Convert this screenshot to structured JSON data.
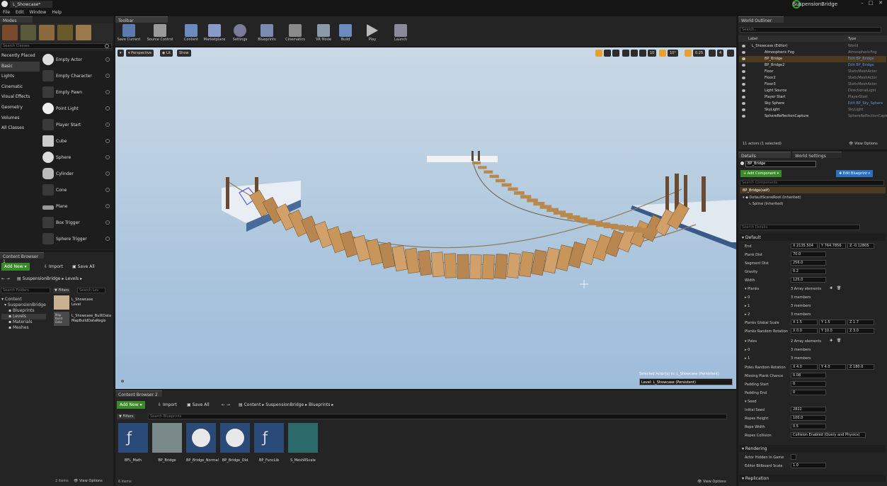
{
  "window": {
    "tab": "L_Showcase*",
    "project": "SuspensionBridge"
  },
  "menu": [
    "File",
    "Edit",
    "Window",
    "Help"
  ],
  "modes": {
    "tab": "Modes",
    "search_placeholder": "Search Classes",
    "categories": [
      "Recently Placed",
      "Basic",
      "Lights",
      "Cinematic",
      "Visual Effects",
      "Geometry",
      "Volumes",
      "All Classes"
    ],
    "selected_category": "Basic",
    "classes": [
      "Empty Actor",
      "Empty Character",
      "Empty Pawn",
      "Point Light",
      "Player Start",
      "Cube",
      "Sphere",
      "Cylinder",
      "Cone",
      "Plane",
      "Box Trigger",
      "Sphere Trigger"
    ]
  },
  "toolbar": {
    "tab": "Toolbar",
    "buttons": [
      "Save Current",
      "Source Control",
      "Content",
      "Marketplace",
      "Settings",
      "Blueprints",
      "Cinematics",
      "VR Mode",
      "Build",
      "Play",
      "Launch"
    ]
  },
  "viewport": {
    "perspective": "Perspective",
    "lit": "Lit",
    "show": "Show",
    "snap_value": "10",
    "rot_value": "10°",
    "scale_value": "0.25",
    "cam_speed": "4",
    "selected_actors": "Selected Actor(s) in: L_Showcase (Persistent)",
    "level": "Level: L_Showcase (Persistent)"
  },
  "content_browser_1": {
    "tab": "Content Browser 1",
    "add_new": "Add New",
    "import": "Import",
    "save_all": "Save All",
    "path": [
      "SuspensionBridge",
      "Levels"
    ],
    "search_folders": "Search Folders",
    "filters": "Filters",
    "search_levels": "Search Lev",
    "tree": [
      "Content",
      "SuspensionBridge",
      "Blueprints",
      "Levels",
      "Materials",
      "Meshes"
    ],
    "assets": [
      {
        "name": "L_Showcase",
        "type": "Level"
      },
      {
        "name": "L_Showcase_BuiltData",
        "type": "MapBuildDataRegis"
      }
    ],
    "asset_thumb_label": "Map Build Data",
    "items": "2 items",
    "view_options": "View Options"
  },
  "content_browser_2": {
    "tab": "Content Browser 2",
    "add_new": "Add New",
    "import": "Import",
    "save_all": "Save All",
    "path": [
      "Content",
      "SuspensionBridge",
      "Blueprints"
    ],
    "filters": "Filters",
    "search_placeholder": "Search Blueprints",
    "assets": [
      "BFL_Math",
      "BP_Bridge",
      "BP_Bridge_Normal",
      "BP_Bridge_Old",
      "BP_FuncLib",
      "S_MeshRScale"
    ],
    "items": "6 items",
    "view_options": "View Options"
  },
  "outliner": {
    "tab": "World Outliner",
    "search_placeholder": "Search...",
    "col_label": "Label",
    "col_type": "Type",
    "rows": [
      {
        "label": "L_Showcase (Editor)",
        "type": "World",
        "blue": false,
        "sel": false
      },
      {
        "label": "Atmospheric Fog",
        "type": "AtmosphericFog",
        "blue": false,
        "sel": false
      },
      {
        "label": "BP_Bridge",
        "type": "Edit BP_Bridge",
        "blue": true,
        "sel": true
      },
      {
        "label": "BP_Bridge2",
        "type": "Edit BP_Bridge",
        "blue": true,
        "sel": false
      },
      {
        "label": "Floor",
        "type": "StaticMeshActor",
        "blue": false,
        "sel": false
      },
      {
        "label": "Floor2",
        "type": "StaticMeshActor",
        "blue": false,
        "sel": false
      },
      {
        "label": "Floor3",
        "type": "StaticMeshActor",
        "blue": false,
        "sel": false
      },
      {
        "label": "Light Source",
        "type": "DirectionalLight",
        "blue": false,
        "sel": false
      },
      {
        "label": "Player Start",
        "type": "PlayerStart",
        "blue": false,
        "sel": false
      },
      {
        "label": "Sky Sphere",
        "type": "Edit BP_Sky_Sphere",
        "blue": true,
        "sel": false
      },
      {
        "label": "SkyLight",
        "type": "SkyLight",
        "blue": false,
        "sel": false
      },
      {
        "label": "SphereReflectionCapture",
        "type": "SphereReflectionCapture",
        "blue": false,
        "sel": false
      }
    ],
    "count": "11 actors (1 selected)",
    "view_options": "View Options"
  },
  "details": {
    "tab": "Details",
    "tab2": "World Settings",
    "name": "BP_Bridge",
    "add_component": "+ Add Component",
    "edit_blueprint": "Edit Blueprint",
    "search_components": "Search Components",
    "self": "BP_Bridge(self)",
    "root": "DefaultSceneRoot (Inherited)",
    "spline": "Spline (Inherited)",
    "search_details": "Search Details",
    "section_default": "Default",
    "end_x": "X 2135.504",
    "end_y": "Y 764.7856",
    "end_z": "Z -0.12805",
    "props": [
      {
        "label": "End",
        "value": ""
      },
      {
        "label": "Plank Dist",
        "value": "70.0"
      },
      {
        "label": "Segment Dist",
        "value": "256.0"
      },
      {
        "label": "Gravity",
        "value": "0.2"
      },
      {
        "label": "Width",
        "value": "125.0"
      }
    ],
    "planks_label": "Planks",
    "planks_value": "3 Array elements",
    "plank_items": [
      {
        "idx": "0",
        "val": "3 members"
      },
      {
        "idx": "1",
        "val": "3 members"
      },
      {
        "idx": "2",
        "val": "3 members"
      }
    ],
    "planks_scale_label": "Planks Global Scale",
    "planks_scale": [
      "X 1.5",
      "Y 1.5",
      "Z 1.7"
    ],
    "planks_rot_label": "Planks Random Rotation",
    "planks_rot": [
      "X 0.0",
      "Y 10.0",
      "Z 3.0"
    ],
    "poles_label": "Poles",
    "poles_value": "2 Array elements",
    "pole_items": [
      {
        "idx": "0",
        "val": "3 members"
      },
      {
        "idx": "1",
        "val": "3 members"
      }
    ],
    "poles_rot_label": "Poles Random Rotation",
    "poles_rot": [
      "X 4.0",
      "Y 4.0",
      "Z 180.0"
    ],
    "props2": [
      {
        "label": "Missing Plank Chance",
        "value": "0.08"
      },
      {
        "label": "Padding Start",
        "value": "0"
      },
      {
        "label": "Padding End",
        "value": "0"
      }
    ],
    "seed_label": "Seed",
    "props3": [
      {
        "label": "Initial Seed",
        "value": "2822"
      },
      {
        "label": "Ropes Height",
        "value": "100.0"
      },
      {
        "label": "Rope Width",
        "value": "0.5"
      }
    ],
    "ropes_collision_label": "Ropes Collision",
    "ropes_collision_value": "Collision Enabled (Query and Physics)",
    "section_rendering": "Rendering",
    "actor_hidden": "Actor Hidden In Game",
    "billboard_scale": "Editor Billboard Scale",
    "billboard_value": "1.0",
    "section_replication": "Replication"
  },
  "colors": {
    "accent_orange": "#e8a030",
    "green": "#3a8a2a",
    "blue": "#2c6fbf",
    "selected": "#4a3a20"
  }
}
